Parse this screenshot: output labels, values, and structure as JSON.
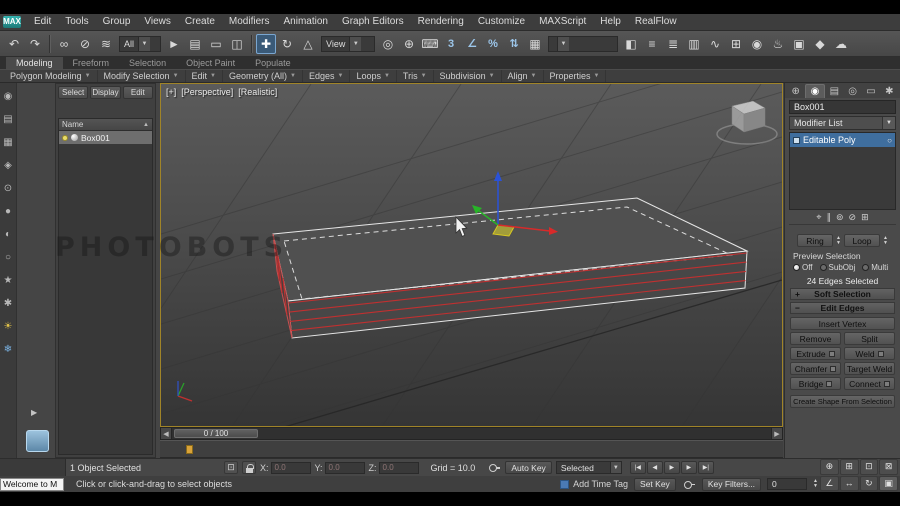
{
  "app": {
    "logo": "MAX"
  },
  "menu": {
    "items": [
      "Edit",
      "Tools",
      "Group",
      "Views",
      "Create",
      "Modifiers",
      "Animation",
      "Graph Editors",
      "Rendering",
      "Customize",
      "MAXScript",
      "Help",
      "RealFlow"
    ]
  },
  "toolbar": {
    "filter_value": "All",
    "view_value": "View",
    "named_selection_value": "",
    "tb1": [
      {
        "name": "undo-icon",
        "glyph": "↶"
      },
      {
        "name": "redo-icon",
        "glyph": "↷"
      }
    ],
    "tb2": [
      {
        "name": "select-and-link-icon",
        "glyph": "∞"
      },
      {
        "name": "unlink-selection-icon",
        "glyph": "⊘"
      },
      {
        "name": "bind-to-space-warp-icon",
        "glyph": "≋"
      }
    ],
    "tb3": [
      {
        "name": "select-object-icon",
        "glyph": "►"
      },
      {
        "name": "select-by-name-icon",
        "glyph": "▤"
      },
      {
        "name": "rectangular-selection-region-icon",
        "glyph": "▭"
      },
      {
        "name": "window-crossing-icon",
        "glyph": "◫"
      }
    ],
    "tb4": [
      {
        "name": "select-and-move-icon",
        "glyph": "✚",
        "active": true
      },
      {
        "name": "select-and-rotate-icon",
        "glyph": "↻"
      },
      {
        "name": "select-and-scale-icon",
        "glyph": "△"
      }
    ],
    "tb5": [
      {
        "name": "use-pivot-center-icon",
        "glyph": "◎"
      },
      {
        "name": "select-and-manipulate-icon",
        "glyph": "⊕"
      },
      {
        "name": "keyboard-override-icon",
        "glyph": "⌨"
      },
      {
        "name": "snaps-toggle-icon",
        "glyph": "3",
        "blue": true
      },
      {
        "name": "angle-snap-icon",
        "glyph": "∠",
        "blue": true
      },
      {
        "name": "percent-snap-icon",
        "glyph": "%",
        "blue": true
      },
      {
        "name": "spinner-snap-icon",
        "glyph": "⇅",
        "blue": true
      },
      {
        "name": "edit-named-selection-sets-icon",
        "glyph": "▦"
      }
    ],
    "tb6": [
      {
        "name": "mirror-icon",
        "glyph": "◧"
      },
      {
        "name": "align-icon",
        "glyph": "≡"
      },
      {
        "name": "layer-manager-icon",
        "glyph": "≣"
      },
      {
        "name": "ribbon-toggle-icon",
        "glyph": "▥"
      },
      {
        "name": "curve-editor-icon",
        "glyph": "∿"
      },
      {
        "name": "schematic-view-icon",
        "glyph": "⊞"
      },
      {
        "name": "material-editor-icon",
        "glyph": "◉"
      },
      {
        "name": "render-setup-icon",
        "glyph": "♨"
      },
      {
        "name": "rendered-frame-window-icon",
        "glyph": "▣"
      },
      {
        "name": "render-production-icon",
        "glyph": "◆"
      },
      {
        "name": "render-cloud-icon",
        "glyph": "☁"
      }
    ]
  },
  "ribbon": {
    "tabs": [
      "Modeling",
      "Freeform",
      "Selection",
      "Object Paint",
      "Populate"
    ],
    "active_tab": "Modeling",
    "tools": [
      "Polygon Modeling",
      "Modify Selection",
      "Edit",
      "Geometry (All)",
      "Edges",
      "Loops",
      "Tris",
      "Subdivision",
      "Align",
      "Properties"
    ]
  },
  "left_toolbar": {
    "icons": [
      {
        "name": "left-tool-compass-icon",
        "glyph": "◉"
      },
      {
        "name": "left-tool-layers-icon",
        "glyph": "▤"
      },
      {
        "name": "left-tool-grid-icon",
        "glyph": "▦"
      },
      {
        "name": "left-tool-gem-icon",
        "glyph": "◈"
      },
      {
        "name": "left-tool-target-icon",
        "glyph": "⊙"
      },
      {
        "name": "left-tool-sphere-icon",
        "glyph": "●"
      },
      {
        "name": "left-tool-contrast-icon",
        "glyph": "◐"
      },
      {
        "name": "left-tool-circle-icon",
        "glyph": "○"
      },
      {
        "name": "left-tool-star-icon",
        "glyph": "★"
      },
      {
        "name": "left-tool-burst-icon",
        "glyph": "✱"
      },
      {
        "name": "left-tool-sun-icon",
        "glyph": "☀",
        "tone": "warm"
      },
      {
        "name": "left-tool-snowflake-icon",
        "glyph": "❄",
        "tone": "cool"
      }
    ]
  },
  "scene_explorer": {
    "tabs": [
      "Select",
      "Display",
      "Edit"
    ],
    "name_header": "Name",
    "rows": [
      {
        "name": "Box001"
      }
    ]
  },
  "viewport": {
    "label_general": "[+]",
    "label_pov": "[Perspective]",
    "label_shading": "[Realistic]",
    "watermark": "PHOTOBOTS"
  },
  "timeline": {
    "value": "0 / 100"
  },
  "command_panel": {
    "tabs": [
      {
        "name": "create-tab-icon",
        "glyph": "⊕"
      },
      {
        "name": "modify-tab-icon",
        "glyph": "◉",
        "active": true
      },
      {
        "name": "hierarchy-tab-icon",
        "glyph": "▤"
      },
      {
        "name": "motion-tab-icon",
        "glyph": "◎"
      },
      {
        "name": "display-tab-icon",
        "glyph": "▭"
      },
      {
        "name": "utilities-tab-icon",
        "glyph": "✱"
      }
    ],
    "object_name": "Box001",
    "modifier_list_label": "Modifier List",
    "stack_item": "Editable Poly",
    "stack_tools": [
      {
        "name": "pin-stack-icon",
        "glyph": "⌖"
      },
      {
        "name": "show-end-result-icon",
        "glyph": "∥"
      },
      {
        "name": "make-unique-icon",
        "glyph": "⊚"
      },
      {
        "name": "remove-modifier-icon",
        "glyph": "⊘"
      },
      {
        "name": "configure-modifier-sets-icon",
        "glyph": "⊞"
      }
    ],
    "ring_label": "Ring",
    "loop_label": "Loop",
    "preview_selection_label": "Preview Selection",
    "preview_options": [
      {
        "label": "Off",
        "selected": true
      },
      {
        "label": "SubObj"
      },
      {
        "label": "Multi"
      }
    ],
    "selection_info": "24 Edges Selected",
    "soft_selection_header": "Soft Selection",
    "edit_edges_header": "Edit Edges",
    "insert_vertex": "Insert Vertex",
    "remove": "Remove",
    "split": "Split",
    "extrude": "Extrude",
    "weld": "Weld",
    "chamfer": "Chamfer",
    "target_weld": "Target Weld",
    "bridge": "Bridge",
    "connect": "Connect",
    "create_shape": "Create Shape From Selection"
  },
  "status": {
    "selection_text": "1 Object Selected",
    "x_label": "X:",
    "y_label": "Y:",
    "z_label": "Z:",
    "x_value": "0.0",
    "y_value": "0.0",
    "z_value": "0.0",
    "grid_text": "Grid = 10.0",
    "auto_key": "Auto Key",
    "selection_set": "Selected",
    "set_key": "Set Key",
    "key_filters": "Key Filters...",
    "frame_value": "0",
    "welcome_tooltip": "Welcome to M",
    "prompt": "Click or click-and-drag to select objects",
    "add_time_tag": "Add Time Tag",
    "transport": [
      {
        "name": "go-to-start-icon",
        "glyph": "|◀"
      },
      {
        "name": "previous-frame-icon",
        "glyph": "◀"
      },
      {
        "name": "play-icon",
        "glyph": "▶"
      },
      {
        "name": "next-frame-icon",
        "glyph": "▶"
      },
      {
        "name": "go-to-end-icon",
        "glyph": "▶|"
      }
    ],
    "nav": [
      {
        "name": "zoom-icon",
        "glyph": "⊕"
      },
      {
        "name": "zoom-all-icon",
        "glyph": "⊞"
      },
      {
        "name": "zoom-extents-icon",
        "glyph": "⊡"
      },
      {
        "name": "zoom-extents-all-icon",
        "glyph": "⊠"
      },
      {
        "name": "field-of-view-icon",
        "glyph": "∠"
      },
      {
        "name": "pan-icon",
        "glyph": "↔"
      },
      {
        "name": "orbit-icon",
        "glyph": "↻"
      },
      {
        "name": "maximize-viewport-icon",
        "glyph": "▣"
      }
    ]
  },
  "colors": {
    "selection_highlight": "#3f6e9e",
    "selected_edge_red": "#c84040",
    "axis_x_red": "#d82a2a",
    "axis_y_green": "#28b428",
    "axis_z_blue": "#2a52d8",
    "viewport_border_yellow": "#a08428",
    "autokey_red": "#9e2a2a"
  }
}
